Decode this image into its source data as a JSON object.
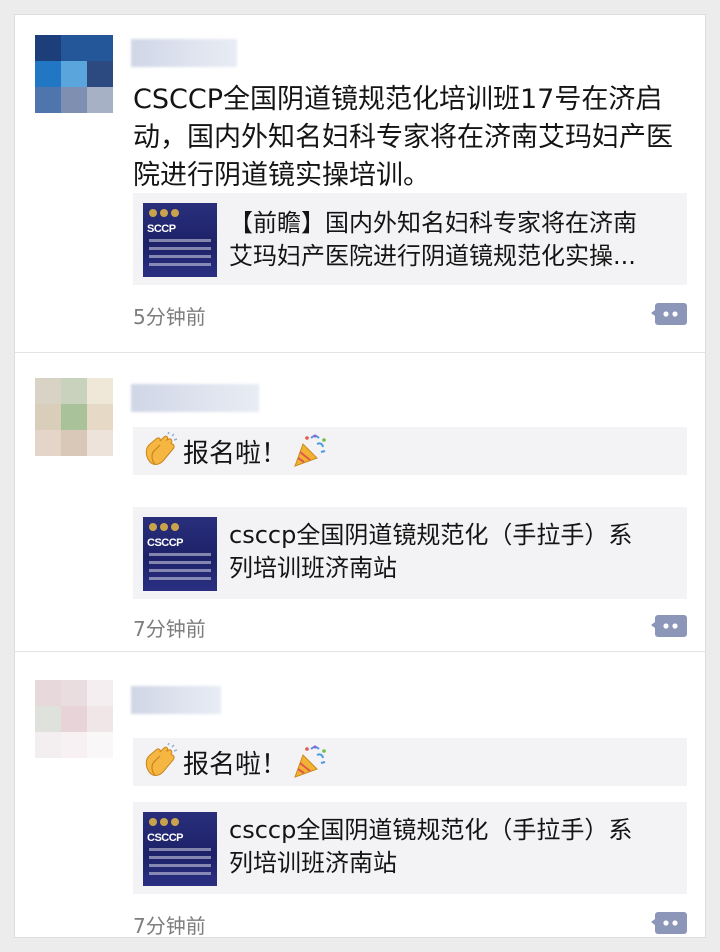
{
  "colors": {
    "background": "#ececec",
    "card": "#ffffff",
    "link_card_bg": "#f3f3f5",
    "comment_icon": "#8b96b8",
    "thumb_navy": "#1d2168"
  },
  "posts": [
    {
      "text": "CSCCP全国阴道镜规范化培训班17号在济启动，国内外知名妇科专家将在济南艾玛妇产医院进行阴道镜实操培训。",
      "link": {
        "title_line1": "【前瞻】国内外知名妇科专家将在济南",
        "title_line2": "艾玛妇产医院进行阴道镜规范化实操...",
        "thumb_label": "SCCP"
      },
      "time": "5分钟前",
      "icons": {
        "avatar": "avatar-icon",
        "comment": "comment-icon"
      }
    },
    {
      "status": "报名啦！",
      "link": {
        "title_line1": "csccp全国阴道镜规范化（手拉手）系",
        "title_line2": "列培训班济南站",
        "thumb_label": "CSCCP"
      },
      "time": "7分钟前",
      "icons": {
        "clap": "clapping-hands-icon",
        "party": "party-popper-icon",
        "comment": "comment-icon"
      }
    },
    {
      "status": "报名啦！",
      "link": {
        "title_line1": "csccp全国阴道镜规范化（手拉手）系",
        "title_line2": "列培训班济南站",
        "thumb_label": "CSCCP"
      },
      "time": "7分钟前",
      "icons": {
        "clap": "clapping-hands-icon",
        "party": "party-popper-icon",
        "comment": "comment-icon"
      }
    }
  ]
}
